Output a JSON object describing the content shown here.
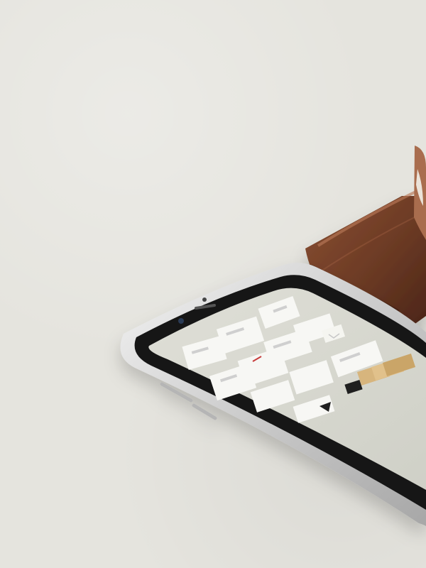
{
  "scene": {
    "background_color": "#e5e4de",
    "objects": [
      "leather-wallet",
      "watch-strap",
      "smartphone",
      "stationery-mockup-screen"
    ]
  },
  "phone": {
    "frame_color": "#cfcfcf",
    "bezel_color": "#1d1d1d",
    "screen_color": "#d8d9d1"
  },
  "wallet": {
    "color": "#6b3a24",
    "accent_color": "#9a5b3a"
  },
  "screen_mockups": {
    "card_color": "#f7f7f4",
    "gold_color": "#d4b27a",
    "dark_card_color": "#1f1f1f"
  }
}
